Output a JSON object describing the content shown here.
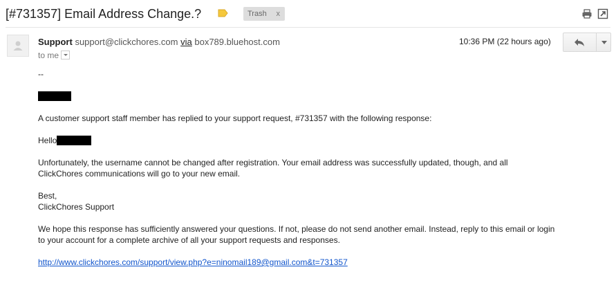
{
  "subject": "[#731357] Email Address Change.?",
  "labels": {
    "trash": "Trash",
    "remove": "x"
  },
  "sender": {
    "name": "Support",
    "email": "support@clickchores.com",
    "via": "via",
    "host": "box789.bluehost.com",
    "recipient": "to me",
    "time": "10:36 PM (22 hours ago)"
  },
  "body": {
    "signature_dash": "--",
    "line1": "A customer support staff member has replied to your support request, #731357 with the following response:",
    "greeting": "Hello",
    "para1_a": "Unfortunately, the username cannot be changed after registration.  Your email address was successfully updated, though, and all",
    "para1_b": "ClickChores communications will go to your new email.",
    "closing": "Best,",
    "closing_sig": "ClickChores Support",
    "para2_a": "We hope this response has sufficiently answered your questions. If not, please do not send another email. Instead, reply to this email or login",
    "para2_b": "to your account for a complete archive of all your support requests and responses.",
    "link": "http://www.clickchores.com/support/view.php?e=ninomail189@gmail.com&t=731357"
  },
  "colors": {
    "link": "#1155cc",
    "label_tag": "#f5c83c",
    "chip_bg": "#dddddd"
  },
  "icons": [
    "label-tag-icon",
    "print-icon",
    "new-window-icon",
    "avatar-icon",
    "reply-icon",
    "chevron-down-icon"
  ]
}
